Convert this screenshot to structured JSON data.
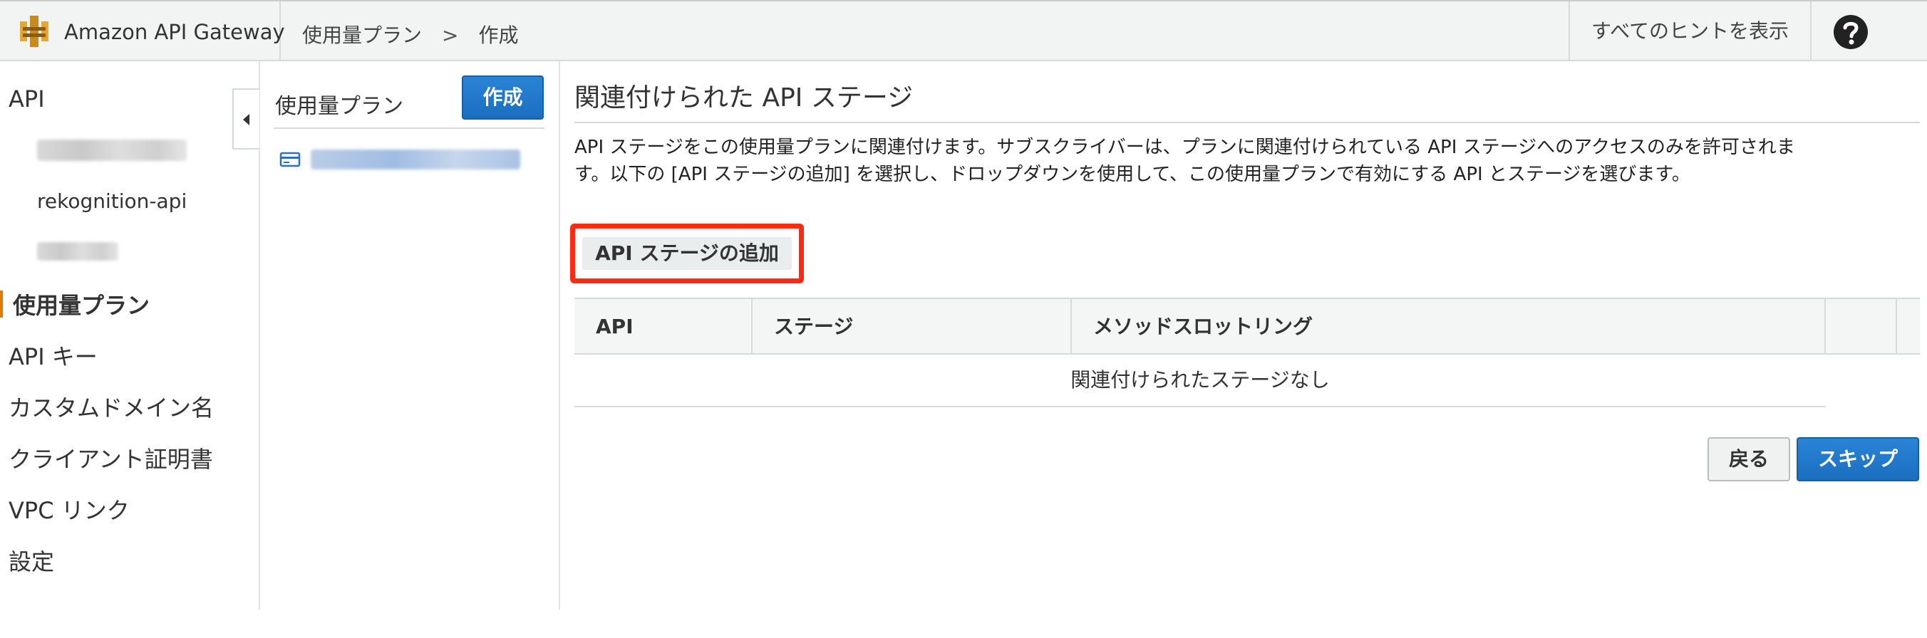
{
  "app": {
    "title": "Amazon API Gateway",
    "logo_icon": "aws-api-gateway-logo-icon"
  },
  "breadcrumb": {
    "items": [
      "使用量プラン",
      "作成"
    ],
    "separator": ">"
  },
  "header": {
    "hints_label": "すべてのヒントを表示",
    "help_icon": "question-circle-icon"
  },
  "sidebar": {
    "api_label": "API",
    "apis": [
      "rekognition-api"
    ],
    "items": [
      "使用量プラン",
      "API キー",
      "カスタムドメイン名",
      "クライアント証明書",
      "VPC リンク",
      "設定"
    ],
    "active": "使用量プラン"
  },
  "plans_panel": {
    "title": "使用量プラン",
    "create_label": "作成",
    "item_icon": "card-icon"
  },
  "main": {
    "heading": "関連付けられた API ステージ",
    "description_line1": "API ステージをこの使用量プランに関連付けます。サブスクライバーは、プランに関連付けられている API ステージへのアクセスのみを許可されま",
    "description_line2": "す。以下の [API ステージの追加] を選択し、ドロップダウンを使用して、この使用量プランで有効にする API とステージを選びます。",
    "add_stage_label": "API ステージの追加",
    "table": {
      "columns": [
        "API",
        "ステージ",
        "メソッドスロットリング"
      ],
      "empty_message": "関連付けられたステージなし"
    },
    "back_label": "戻る",
    "skip_label": "スキップ"
  },
  "colors": {
    "primary": "#1a6ec0",
    "highlight": "#ff2a10",
    "active_marker": "#e07b00"
  }
}
